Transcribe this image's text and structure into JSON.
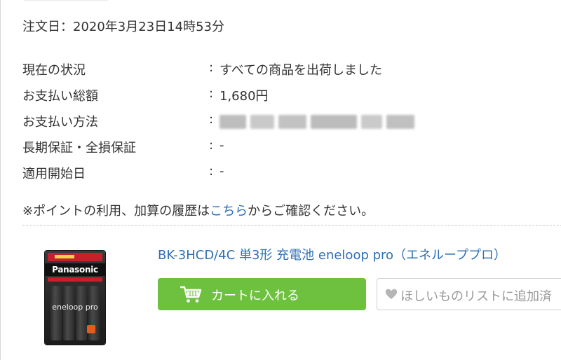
{
  "order": {
    "date_text": "注文日：2020年3月23日14時53分"
  },
  "info_rows": [
    {
      "label": "現在の状況",
      "value": "すべての商品を出荷しました"
    },
    {
      "label": "お支払い総額",
      "value": "1,680円"
    },
    {
      "label": "お支払い方法",
      "value": ""
    },
    {
      "label": "長期保証・全損保証",
      "value": "-"
    },
    {
      "label": "適用開始日",
      "value": "-"
    }
  ],
  "separator": ":",
  "note": {
    "prefix": "※ポイントの利用、加算の履歴は",
    "link": "こちら",
    "suffix": "からご確認ください。"
  },
  "product": {
    "title": "BK-3HCD/4C 単3形 充電池 eneloop pro（エネループプロ）",
    "brand_on_package": "Panasonic",
    "product_line_on_package": "eneloop pro"
  },
  "buttons": {
    "cart_label": "カートに入れる",
    "wishlist_label": "ほしいものリストに追加済"
  },
  "icons": {
    "cart": "shopping-cart-icon",
    "wishlist": "heart-icon"
  },
  "colors": {
    "link": "#2d6fb5",
    "cart_button": "#6ec13e",
    "text": "#333333"
  }
}
